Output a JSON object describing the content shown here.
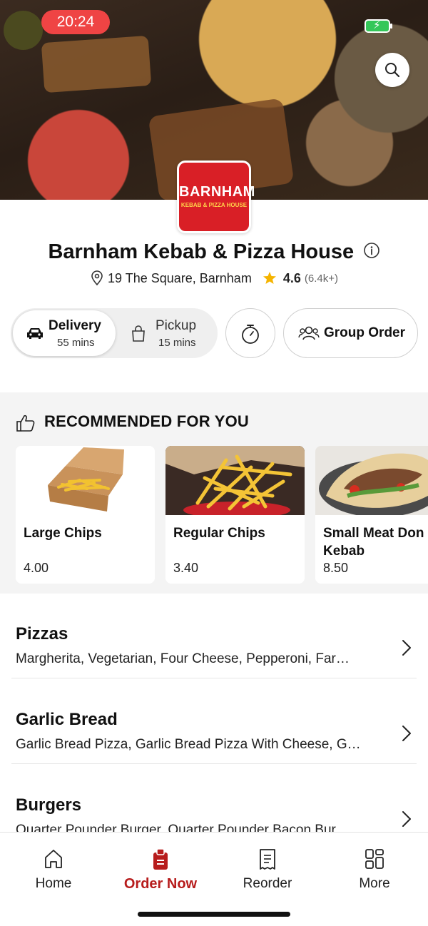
{
  "status_bar": {
    "time": "20:24"
  },
  "restaurant": {
    "logo_line1": "BARNHAM",
    "logo_line2": "KEBAB & PIZZA HOUSE",
    "name": "Barnham Kebab & Pizza House",
    "address": "19 The Square, Barnham",
    "rating": "4.6",
    "rating_count": "(6.4k+)"
  },
  "order_modes": {
    "delivery": {
      "label": "Delivery",
      "time": "55 mins",
      "selected": true
    },
    "pickup": {
      "label": "Pickup",
      "time": "15 mins",
      "selected": false
    },
    "group_order_label": "Group Order"
  },
  "recommended": {
    "heading": "RECOMMENDED FOR YOU",
    "items": [
      {
        "name": "Large Chips",
        "price": "4.00"
      },
      {
        "name": "Regular Chips",
        "price": "3.40"
      },
      {
        "name_line1": "Small Meat Don",
        "name_line2": "Kebab",
        "price": "8.50"
      }
    ]
  },
  "categories": [
    {
      "title": "Pizzas",
      "desc": "Margherita, Vegetarian, Four Cheese, Pepperoni, Far…"
    },
    {
      "title": "Garlic Bread",
      "desc": "Garlic Bread Pizza, Garlic Bread Pizza With Cheese, G…"
    },
    {
      "title": "Burgers",
      "desc": "Quarter Pounder Burger, Quarter Pounder Bacon Bur…"
    }
  ],
  "tabs": [
    {
      "label": "Home",
      "icon": "home-icon",
      "active": false
    },
    {
      "label": "Order Now",
      "icon": "order-bag-icon",
      "active": true
    },
    {
      "label": "Reorder",
      "icon": "receipt-icon",
      "active": false
    },
    {
      "label": "More",
      "icon": "grid-icon",
      "active": false
    }
  ],
  "colors": {
    "brand_red": "#d91f26",
    "active_tab": "#b71c1c",
    "status_pill": "#ef4444",
    "battery": "#34c759",
    "star": "#f5b400"
  }
}
